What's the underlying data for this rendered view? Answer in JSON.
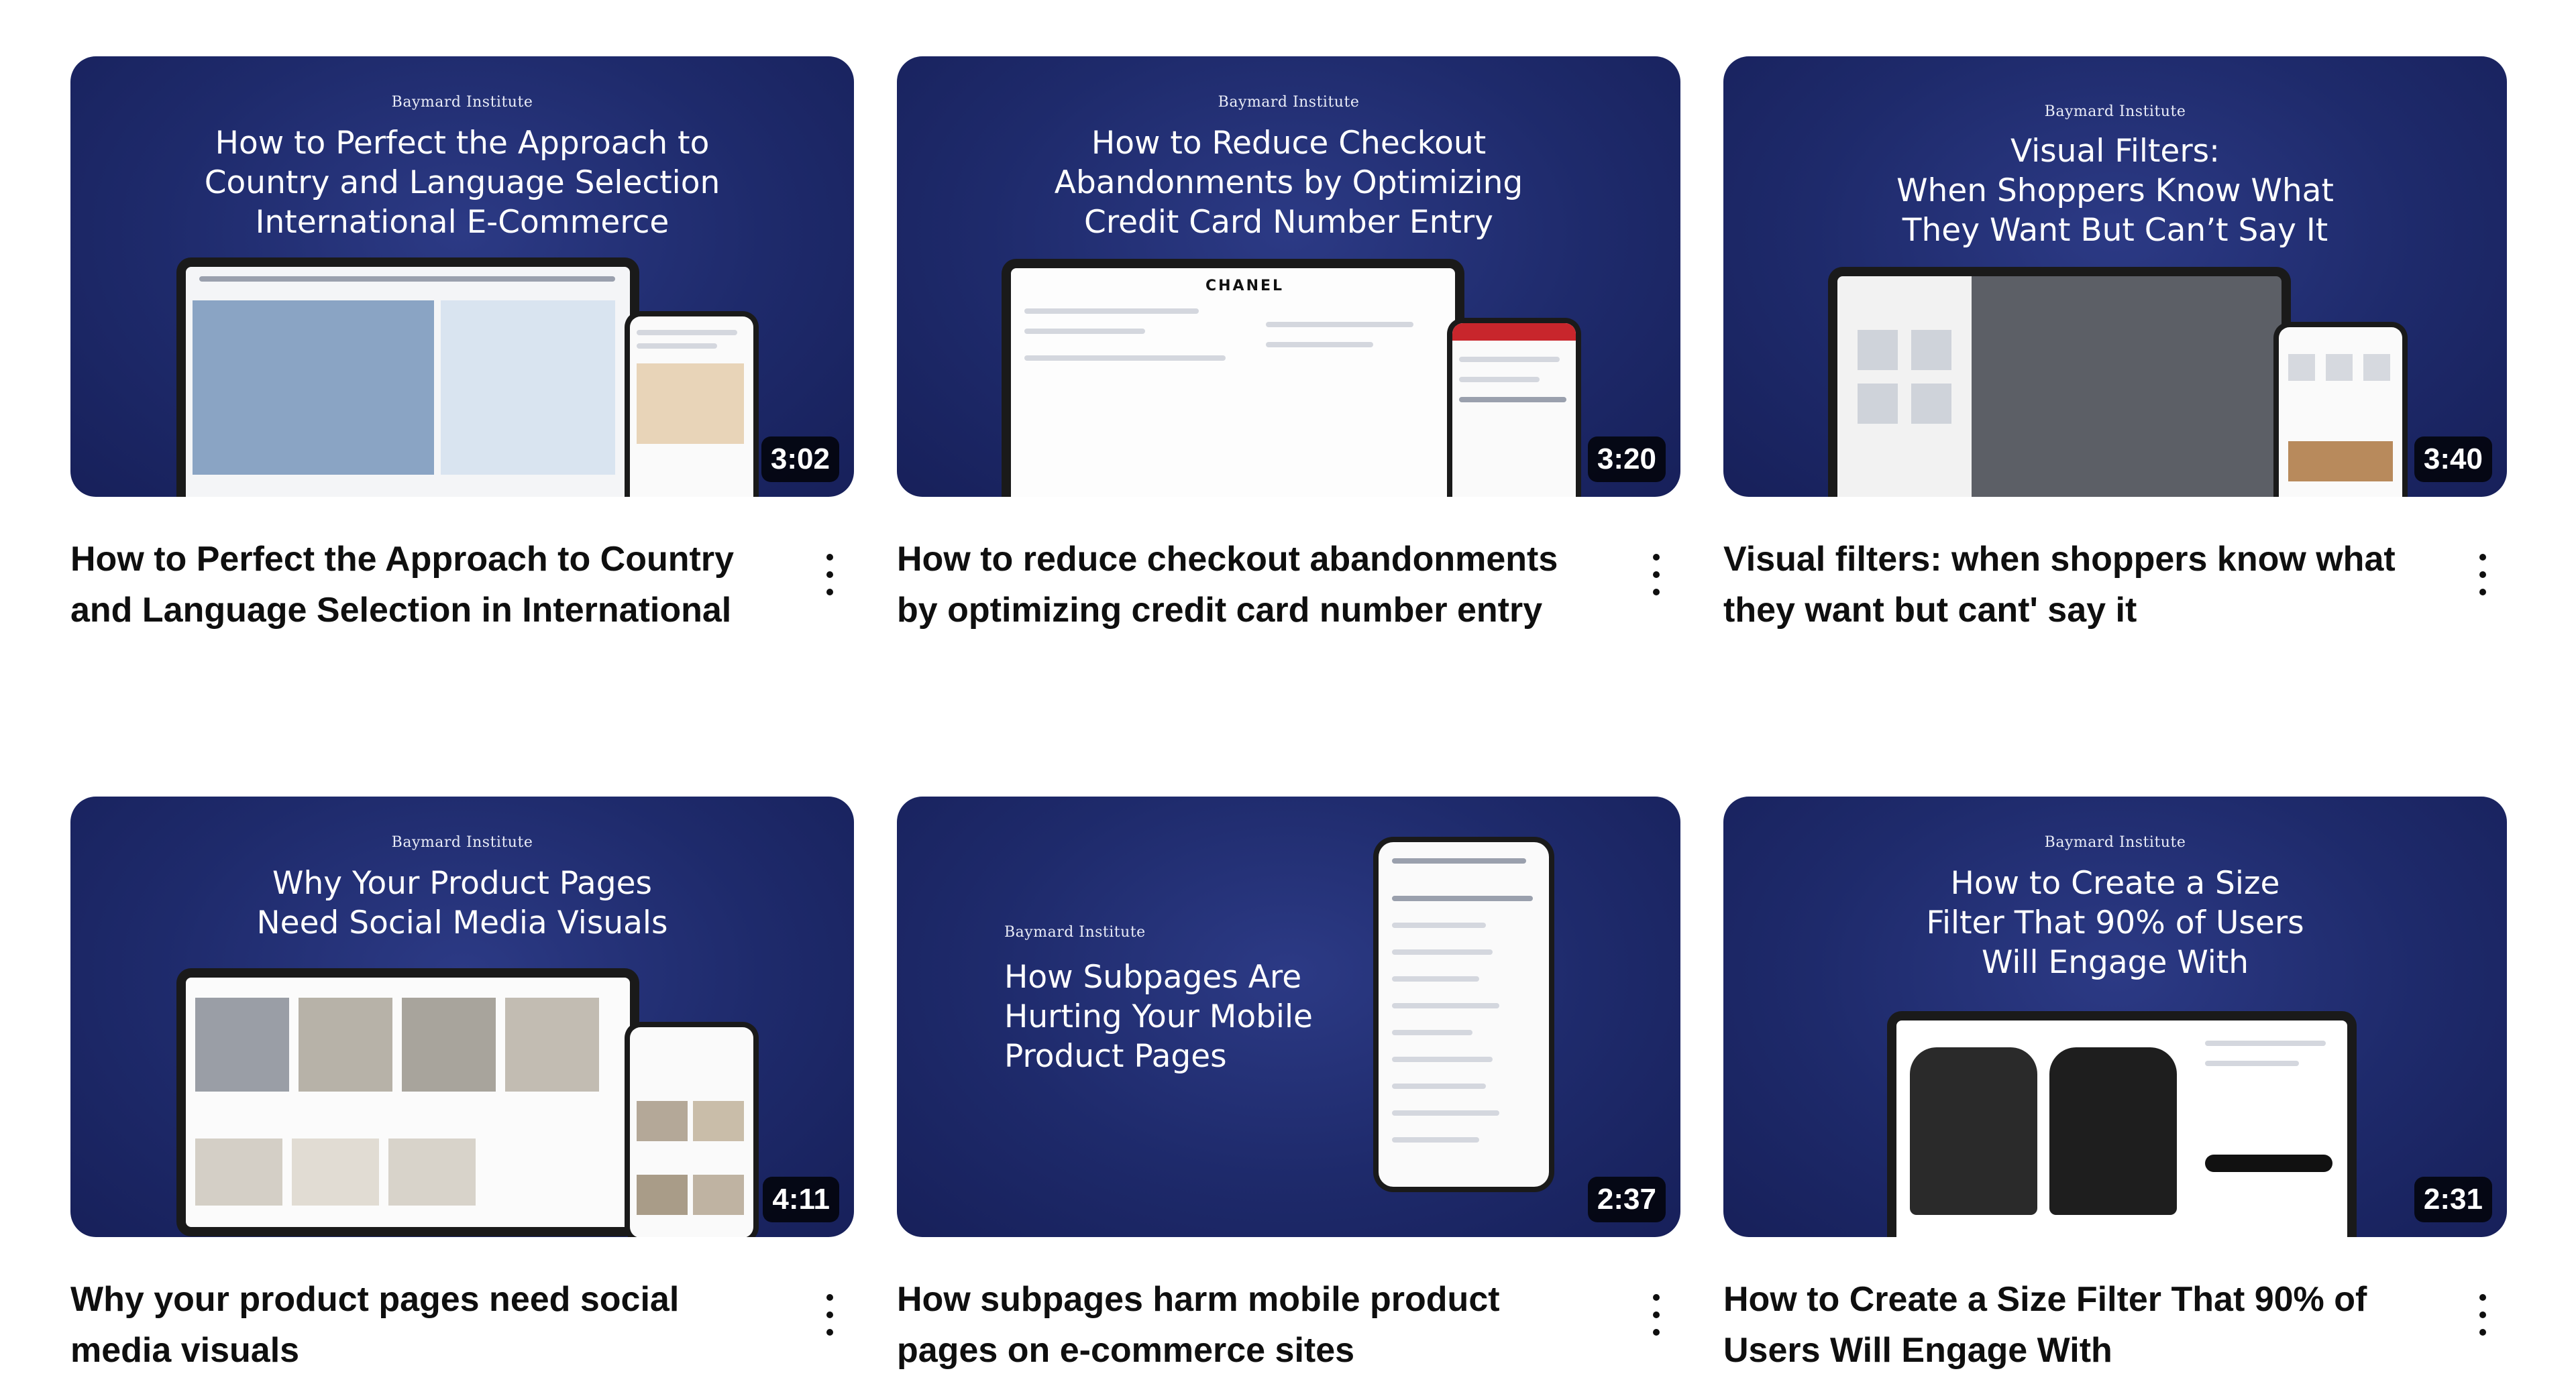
{
  "brand_text": "Baymard Institute",
  "videos": [
    {
      "thumbnail_headline": "How to Perfect the Approach to\nCountry and Language Selection\nInternational E-Commerce",
      "duration": "3:02",
      "title": "How to Perfect the Approach to Country and Language Selection in International E-..."
    },
    {
      "thumbnail_headline": "How to Reduce Checkout\nAbandonments by Optimizing\nCredit Card Number Entry",
      "screen_word": "CHANEL",
      "duration": "3:20",
      "title": "How to reduce checkout abandonments by optimizing credit card number entry"
    },
    {
      "thumbnail_headline": "Visual Filters:\nWhen Shoppers Know What\nThey Want But Can’t Say It",
      "duration": "3:40",
      "title": "Visual filters: when shoppers know what they want but cant' say it"
    },
    {
      "thumbnail_headline": "Why Your Product Pages\nNeed Social Media Visuals",
      "duration": "4:11",
      "title": "Why your product pages need social media visuals"
    },
    {
      "thumbnail_headline": "How Subpages Are\nHurting Your Mobile\nProduct Pages",
      "duration": "2:37",
      "title": "How subpages harm mobile product pages on e-commerce sites"
    },
    {
      "thumbnail_headline": "How to Create a Size\nFilter That 90% of Users\nWill Engage With",
      "duration": "2:31",
      "title": "How to Create a Size Filter That 90% of Users Will Engage With"
    }
  ],
  "colors": {
    "thumbnail_bg": "#1e2a6b",
    "duration_bg": "#000000",
    "title_text": "#0f0f0f"
  },
  "icons": {
    "more_menu": "more-vert-icon"
  }
}
